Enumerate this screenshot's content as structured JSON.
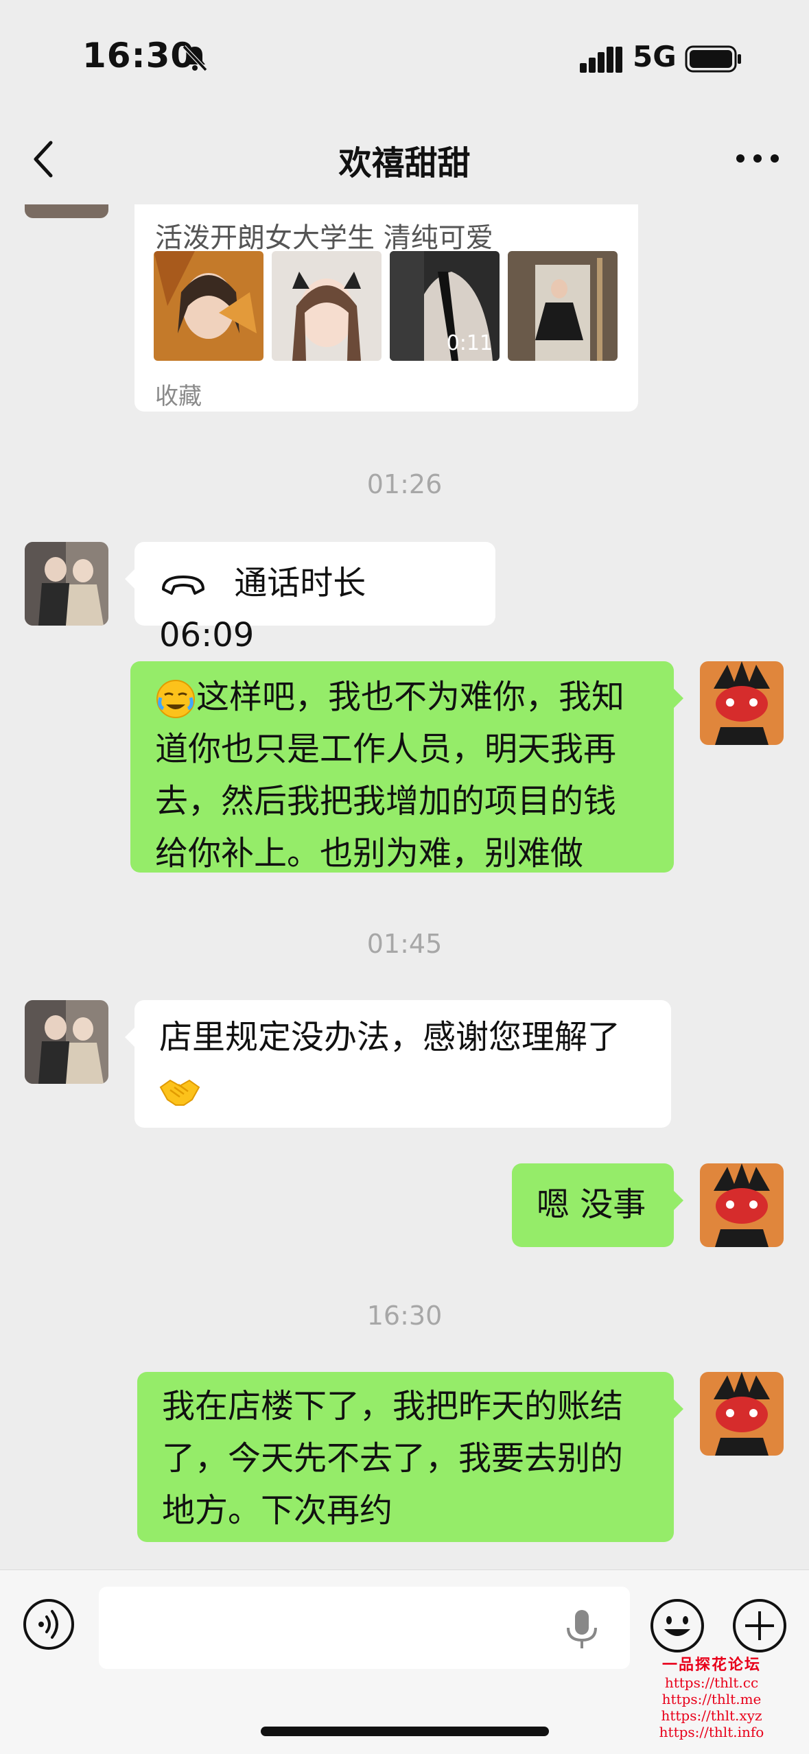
{
  "status_bar": {
    "time": "16:30",
    "network": "5G",
    "icons": [
      "bell-muted-icon",
      "signal-icon",
      "battery-icon"
    ]
  },
  "nav": {
    "title": "欢禧甜甜",
    "back_icon": "chevron-left-icon",
    "more_icon": "ellipsis-icon"
  },
  "profile_card": {
    "subtitle": "活泼开朗女大学生 清纯可爱",
    "thumbnails": [
      {
        "type": "image"
      },
      {
        "type": "image"
      },
      {
        "type": "video",
        "duration": "0:11"
      },
      {
        "type": "image"
      }
    ],
    "footer": "收藏"
  },
  "messages": [
    {
      "type": "time",
      "text": "01:26"
    },
    {
      "type": "call",
      "side": "left",
      "icon": "phone-hangup-icon",
      "text": "通话时长 06:09"
    },
    {
      "type": "text",
      "side": "right",
      "emoji": "crying-face",
      "lines": [
        "这样吧，我也不为难你，我知",
        "道你也只是工作人员，明天我再",
        "去，然后我把我增加的项目的钱",
        "给你补上。也别为难，别难做"
      ]
    },
    {
      "type": "time",
      "text": "01:45"
    },
    {
      "type": "text",
      "side": "left",
      "emoji": "handshake",
      "lines": [
        "店里规定没办法，感谢您理解了"
      ]
    },
    {
      "type": "text",
      "side": "right",
      "text": "嗯 没事"
    },
    {
      "type": "time",
      "text": "16:30"
    },
    {
      "type": "text",
      "side": "right",
      "lines": [
        "我在店楼下了，我把昨天的账结",
        "了，今天先不去了，我要去别的",
        "地方。下次再约"
      ]
    }
  ],
  "input_bar": {
    "placeholder": "",
    "icons": [
      "voice-icon",
      "microphone-icon",
      "emoji-icon",
      "plus-icon"
    ]
  },
  "watermark": {
    "title": "一品探花论坛",
    "links": [
      "https://thlt.cc",
      "https://thlt.me",
      "https://thlt.xyz",
      "https://thlt.info"
    ]
  },
  "colors": {
    "background": "#ededed",
    "bubble_self": "#95ec69",
    "bubble_other": "#ffffff",
    "watermark": "#e8001a"
  }
}
